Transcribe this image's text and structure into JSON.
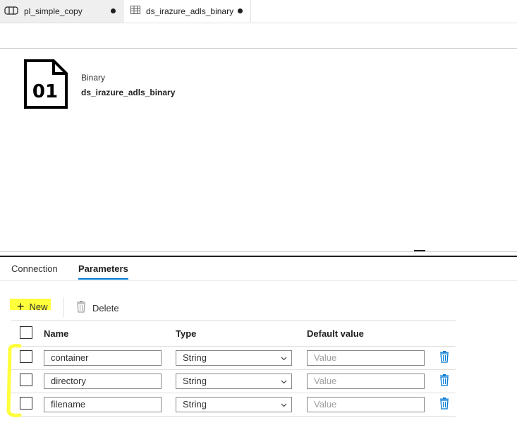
{
  "tabs": [
    {
      "label": "pl_simple_copy",
      "icon": "pipeline-icon",
      "unsaved": true,
      "active": false
    },
    {
      "label": "ds_irazure_adls_binary",
      "icon": "table-icon",
      "unsaved": true,
      "active": true
    }
  ],
  "dataset": {
    "icon_text": "01",
    "type": "Binary",
    "name": "ds_irazure_adls_binary"
  },
  "bottom_tabs": [
    {
      "label": "Connection",
      "active": false
    },
    {
      "label": "Parameters",
      "active": true
    }
  ],
  "toolbar": {
    "new_label": "New",
    "delete_label": "Delete"
  },
  "grid": {
    "columns": [
      "Name",
      "Type",
      "Default value"
    ],
    "rows": [
      {
        "name": "container",
        "type": "String",
        "default_placeholder": "Value"
      },
      {
        "name": "directory",
        "type": "String",
        "default_placeholder": "Value"
      },
      {
        "name": "filename",
        "type": "String",
        "default_placeholder": "Value"
      }
    ]
  },
  "colors": {
    "accent": "#0078d4",
    "highlight": "#ffff3c",
    "trash_icon": "#0078d4"
  }
}
